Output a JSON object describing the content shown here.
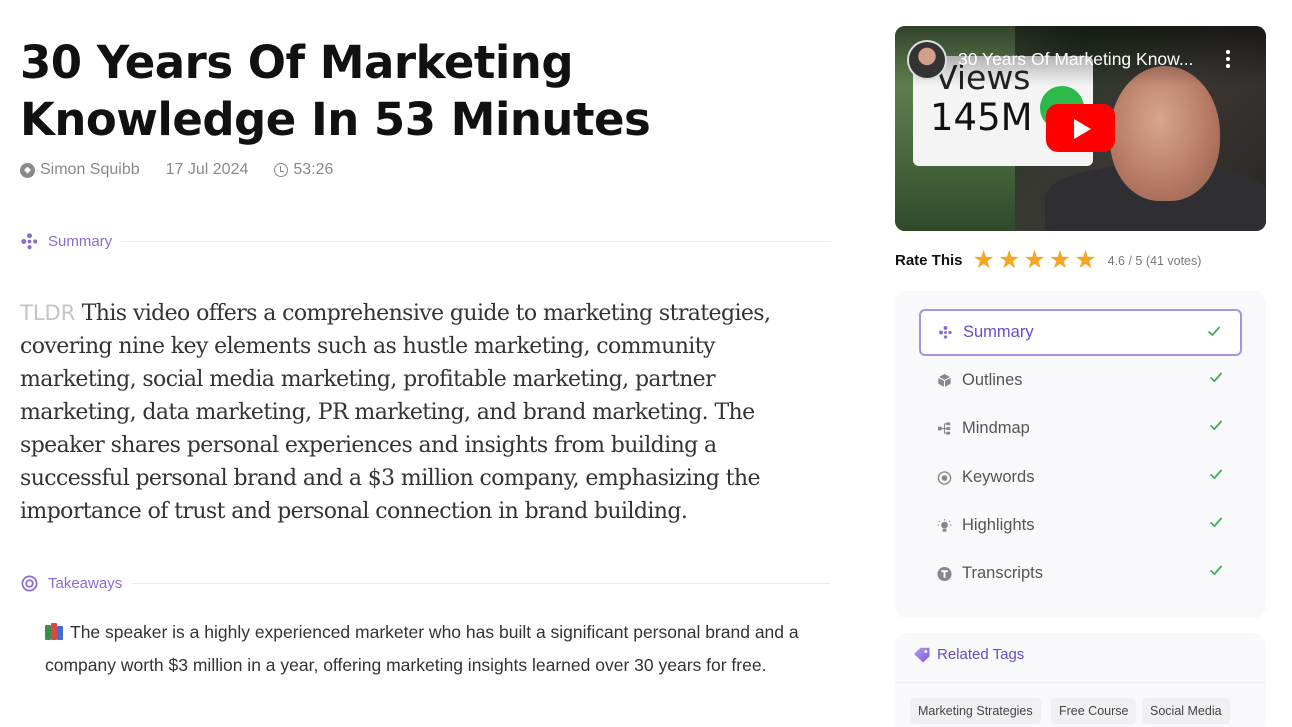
{
  "article": {
    "title": "30 Years Of Marketing Knowledge In 53 Minutes",
    "author": "Simon Squibb",
    "date": "17 Jul 2024",
    "duration": "53:26"
  },
  "summary_section": {
    "label": "Summary",
    "tldr_tag": "TLDR",
    "tldr_text": "This video offers a comprehensive guide to marketing strategies, covering nine key elements such as hustle marketing, community marketing, social media marketing, profitable marketing, partner marketing, data marketing, PR marketing, and brand marketing. The speaker shares personal experiences and insights from building a successful personal brand and a $3 million company, emphasizing the importance of trust and personal connection in brand building."
  },
  "takeaways_section": {
    "label": "Takeaways",
    "items": [
      {
        "icon": "books-icon",
        "text": "The speaker is a highly experienced marketer who has built a significant personal brand and a company worth $3 million in a year, offering marketing insights learned over 30 years for free."
      }
    ]
  },
  "video": {
    "title": "30 Years Of Marketing Know...",
    "thumbnail_views_label": "Views",
    "thumbnail_views_count": "145M"
  },
  "rating": {
    "label": "Rate This",
    "stars_filled": 5,
    "stars_total": 5,
    "score_text": "4.6 / 5 (41 votes)"
  },
  "nav": {
    "items": [
      {
        "label": "Summary",
        "icon": "sparkle-icon",
        "active": true,
        "checked": true
      },
      {
        "label": "Outlines",
        "icon": "cube-icon",
        "active": false,
        "checked": true
      },
      {
        "label": "Mindmap",
        "icon": "mindmap-icon",
        "active": false,
        "checked": true
      },
      {
        "label": "Keywords",
        "icon": "target-icon",
        "active": false,
        "checked": true
      },
      {
        "label": "Highlights",
        "icon": "bulb-icon",
        "active": false,
        "checked": true
      },
      {
        "label": "Transcripts",
        "icon": "transcript-icon",
        "active": false,
        "checked": true
      }
    ]
  },
  "related_tags": {
    "label": "Related Tags",
    "tags": [
      "Marketing Strategies",
      "Free Course",
      "Social Media"
    ]
  },
  "colors": {
    "accent_purple": "#8b6ad3",
    "check_green": "#3fae5a",
    "star_orange": "#f5a623",
    "youtube_red": "#ff0000"
  }
}
